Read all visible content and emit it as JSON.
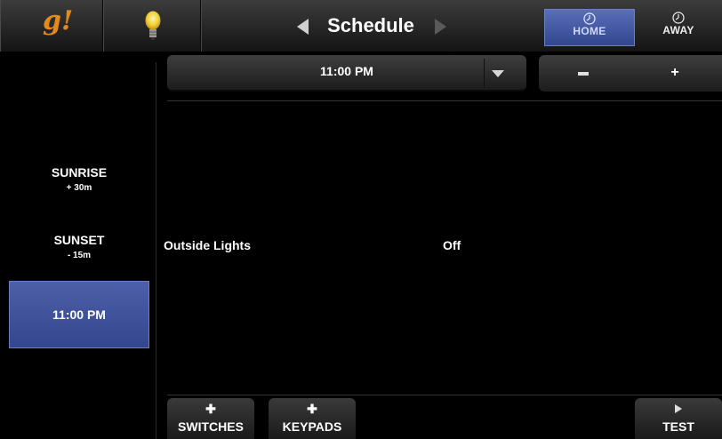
{
  "header": {
    "logo_text": "g!",
    "title": "Schedule",
    "modes": [
      {
        "label": "HOME",
        "active": true
      },
      {
        "label": "AWAY",
        "active": false
      }
    ]
  },
  "events": [
    {
      "name": "SUNRISE",
      "offset": "+ 30m"
    },
    {
      "name": "SUNSET",
      "offset": "- 15m"
    },
    {
      "name": "11:00  PM",
      "selected": true
    }
  ],
  "time_selector": {
    "value": "11:00  PM"
  },
  "stepper": {
    "minus": "−",
    "plus": "+"
  },
  "device": {
    "name": "Outside Lights",
    "state": "Off"
  },
  "bottom_buttons": {
    "switches": "SWITCHES",
    "keypads": "KEYPADS",
    "test": "TEST"
  },
  "colors": {
    "accent_blue": "#3d50a0",
    "logo_orange": "#e38a1c"
  },
  "icons": [
    "lightbulb-icon",
    "clock-icon",
    "plus-icon",
    "play-icon",
    "dropdown-arrow-icon"
  ]
}
